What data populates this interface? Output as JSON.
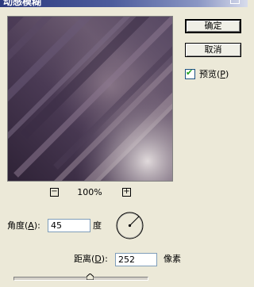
{
  "window": {
    "title": "动感模糊"
  },
  "buttons": {
    "ok_label": "确定",
    "cancel_label": "取消"
  },
  "preview_checkbox": {
    "label_text": "预览(",
    "mnemonic": "P",
    "label_close": ")",
    "checked": true
  },
  "zoom": {
    "out_label": "−",
    "in_label": "+",
    "level": "100%"
  },
  "angle": {
    "label_text": "角度(",
    "mnemonic": "A",
    "label_close": "):",
    "value": "45",
    "unit": "度"
  },
  "distance": {
    "label_text": "距离(",
    "mnemonic": "D",
    "label_close": "):",
    "value": "252",
    "unit": "像素",
    "slider_fraction": 0.57
  },
  "colors": {
    "title_bar": "#2c3a7e",
    "preview_dark": "#3b2b44",
    "preview_mid": "#6d5a72",
    "preview_light": "#b8a9b0"
  }
}
